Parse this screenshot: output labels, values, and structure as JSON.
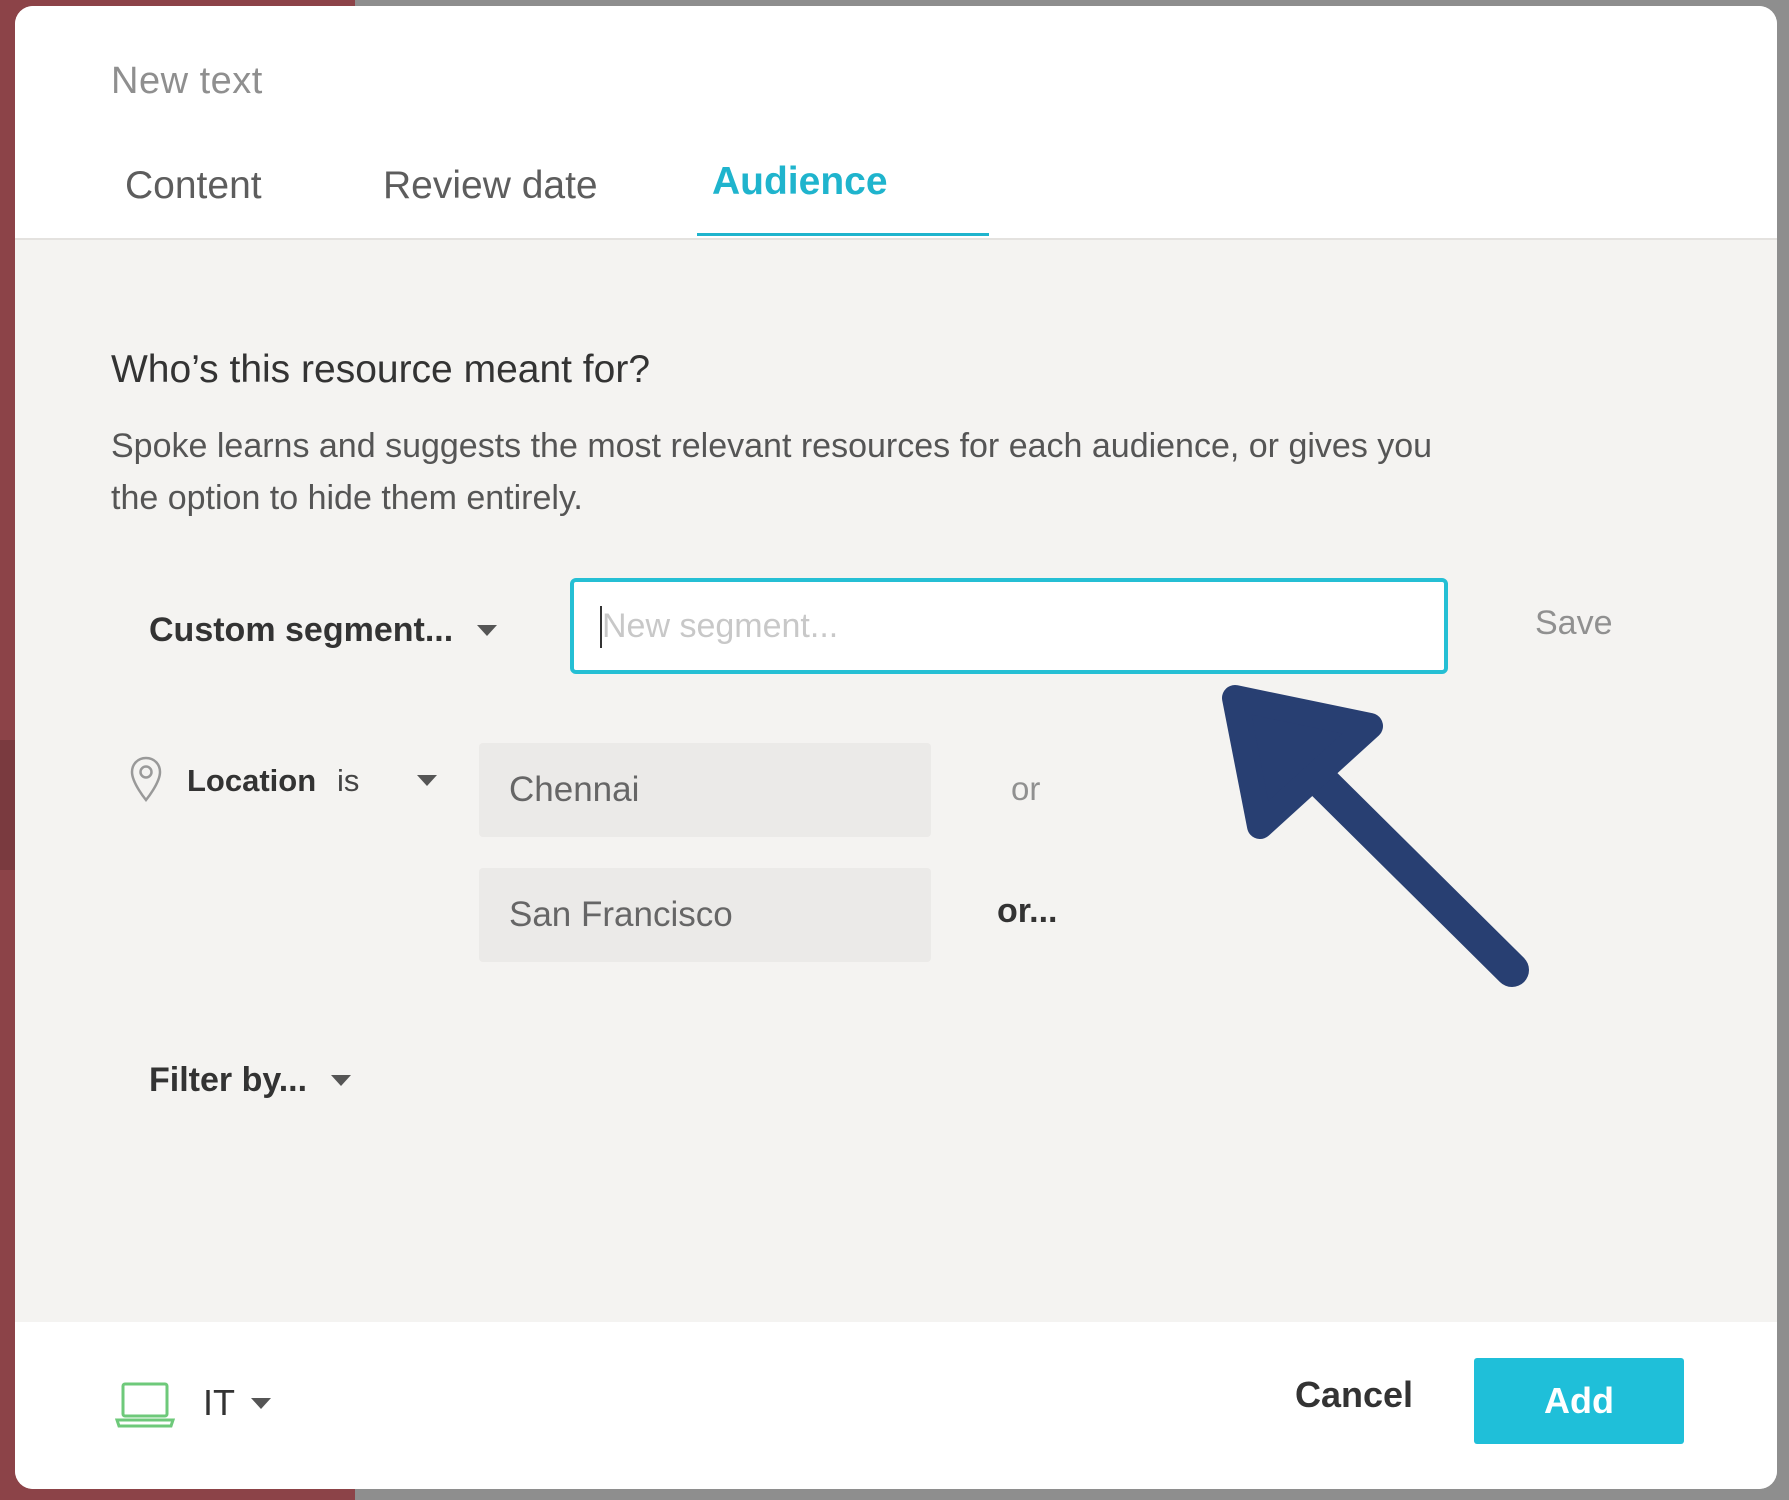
{
  "modal": {
    "title": "New text",
    "tabs": [
      {
        "label": "Content",
        "active": false
      },
      {
        "label": "Review date",
        "active": false
      },
      {
        "label": "Audience",
        "active": true
      }
    ]
  },
  "audience": {
    "heading": "Who’s this resource meant for?",
    "description": "Spoke learns and suggests the most relevant resources for each audience, or gives you the option to hide them entirely.",
    "segment_dropdown": "Custom segment...",
    "segment_input": {
      "value": "",
      "placeholder": "New segment..."
    },
    "save_label": "Save",
    "location": {
      "label": "Location",
      "operator": "is",
      "values": [
        "Chennai",
        "San Francisco"
      ],
      "or_label": "or",
      "or_more_label": "or..."
    },
    "filter_label": "Filter by..."
  },
  "footer": {
    "department": "IT",
    "cancel_label": "Cancel",
    "add_label": "Add"
  },
  "colors": {
    "accent": "#1fbfd9",
    "arrow": "#283f72",
    "icon_green": "#6ec97a"
  }
}
